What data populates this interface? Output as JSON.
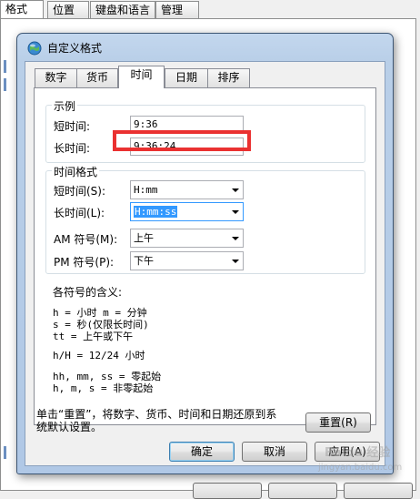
{
  "parent": {
    "tabs": [
      "格式",
      "位置",
      "键盘和语言",
      "管理"
    ],
    "bottom_buttons": [
      "确定",
      "取消",
      "应用"
    ]
  },
  "dialog": {
    "title": "自定义格式",
    "tabs": [
      "数字",
      "货币",
      "时间",
      "日期",
      "排序"
    ],
    "selected_tab": "时间",
    "example": {
      "group_title": "示例",
      "short_label": "短时间:",
      "short_value": "9:36",
      "long_label": "长时间:",
      "long_value": "9:36:24"
    },
    "formats": {
      "group_title": "时间格式",
      "short_label": "短时间(S):",
      "short_value": "H:mm",
      "long_label": "长时间(L):",
      "long_value": "H:mm:ss",
      "am_label": "AM 符号(M):",
      "am_value": "上午",
      "pm_label": "PM 符号(P):",
      "pm_value": "下午"
    },
    "legend": {
      "title": "各符号的含义:",
      "line1": "h = 小时   m = 分钟",
      "line2": "s = 秒(仅限长时间)",
      "line3": "tt = 上午或下午",
      "line4": "h/H = 12/24 小时",
      "line5": "hh, mm, ss = 零起始",
      "line6": "h, m, s = 非零起始"
    },
    "reset_note_line1": "单击“重置”，将数字、货币、时间和日期还原到系",
    "reset_note_line2": "统默认设置。",
    "reset_button": "重置(R)",
    "ok_button": "确定",
    "cancel_button": "取消",
    "apply_button": "应用(A)"
  },
  "colors": {
    "highlight_box": "#ea3131",
    "selection": "#3399ff",
    "title_bar": "#b9cfe8"
  },
  "watermark": {
    "line1": "Baidu 经验",
    "line2": "jingyan.baidu.com"
  }
}
